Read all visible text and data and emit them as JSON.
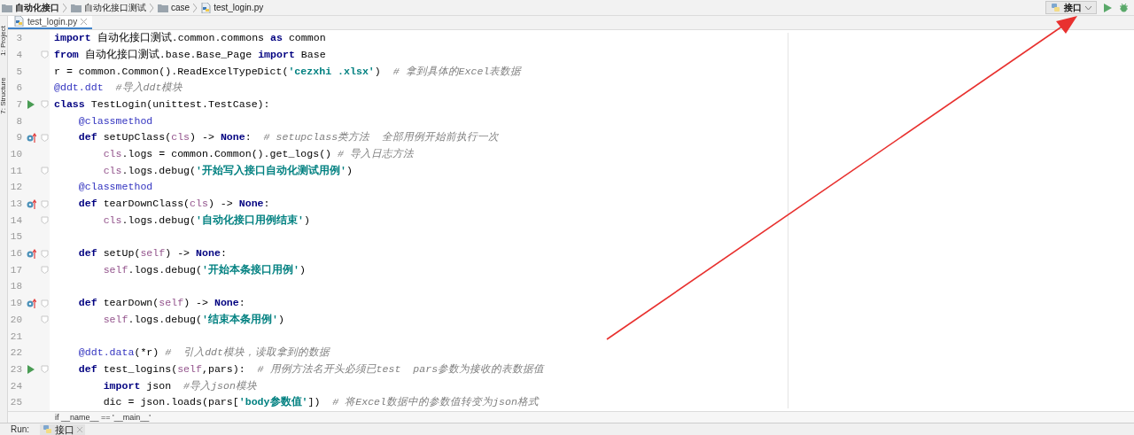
{
  "breadcrumbs": [
    {
      "label": "自动化接口",
      "bold": true
    },
    {
      "label": "自动化接口测试",
      "bold": false
    },
    {
      "label": "case",
      "bold": false
    },
    {
      "label": "test_login.py",
      "bold": false,
      "kind": "file"
    }
  ],
  "toolbar": {
    "run_config": "接口"
  },
  "tool_strip": [
    "1: Project",
    "7: Structure"
  ],
  "tabs": [
    {
      "label": "test_login.py",
      "selected": true
    }
  ],
  "code_lines": [
    {
      "number": "3",
      "fold": false,
      "tokens": [
        {
          "kind": "kw",
          "text": "import"
        },
        {
          "kind": "plain",
          "text": " 自动化接口测试.common.commons "
        },
        {
          "kind": "kw",
          "text": "as"
        },
        {
          "kind": "plain",
          "text": " common"
        }
      ]
    },
    {
      "number": "4",
      "fold": true,
      "tokens": [
        {
          "kind": "kw",
          "text": "from"
        },
        {
          "kind": "plain",
          "text": " 自动化接口测试.base.Base_Page "
        },
        {
          "kind": "kw",
          "text": "import"
        },
        {
          "kind": "plain",
          "text": " Base"
        }
      ]
    },
    {
      "number": "5",
      "fold": false,
      "tokens": [
        {
          "kind": "plain",
          "text": "r = common.Common().ReadExcelTypeDict("
        },
        {
          "kind": "str",
          "text": "'cezxhi .xlsx'"
        },
        {
          "kind": "plain",
          "text": ")"
        },
        {
          "kind": "cm",
          "text": "  # 拿到具体的Excel表数据"
        }
      ]
    },
    {
      "number": "6",
      "fold": false,
      "tokens": [
        {
          "kind": "deco",
          "text": "@ddt.ddt"
        },
        {
          "kind": "cm",
          "text": "  #导入ddt模块"
        }
      ]
    },
    {
      "number": "7",
      "gutter_icon": {
        "kind": "run"
      },
      "fold": true,
      "tokens": [
        {
          "kind": "kw",
          "text": "class"
        },
        {
          "kind": "plain",
          "text": " TestLogin(unittest.TestCase):"
        }
      ]
    },
    {
      "number": "8",
      "fold": false,
      "tokens": [
        {
          "kind": "deco",
          "text": "    @classmethod"
        }
      ]
    },
    {
      "number": "9",
      "gutter_icon": {
        "kind": "override"
      },
      "fold": true,
      "tokens": [
        {
          "kind": "kw",
          "text": "    def"
        },
        {
          "kind": "plain",
          "text": " setUpClass("
        },
        {
          "kind": "self",
          "text": "cls"
        },
        {
          "kind": "plain",
          "text": ") -> "
        },
        {
          "kind": "kw",
          "text": "None"
        },
        {
          "kind": "plain",
          "text": ":"
        },
        {
          "kind": "cm",
          "text": "  # setupclass类方法  全部用例开始前执行一次"
        }
      ]
    },
    {
      "number": "10",
      "fold": false,
      "tokens": [
        {
          "kind": "self",
          "text": "        cls"
        },
        {
          "kind": "plain",
          "text": ".logs = common.Common().get_logs()"
        },
        {
          "kind": "cm",
          "text": " # 导入日志方法"
        }
      ]
    },
    {
      "number": "11",
      "fold": true,
      "tokens": [
        {
          "kind": "self",
          "text": "        cls"
        },
        {
          "kind": "plain",
          "text": ".logs.debug("
        },
        {
          "kind": "str",
          "text": "'开始写入接口自动化测试用例'"
        },
        {
          "kind": "plain",
          "text": ")"
        }
      ]
    },
    {
      "number": "12",
      "fold": false,
      "tokens": [
        {
          "kind": "deco",
          "text": "    @classmethod"
        }
      ]
    },
    {
      "number": "13",
      "gutter_icon": {
        "kind": "override"
      },
      "fold": true,
      "tokens": [
        {
          "kind": "kw",
          "text": "    def"
        },
        {
          "kind": "plain",
          "text": " tearDownClass("
        },
        {
          "kind": "self",
          "text": "cls"
        },
        {
          "kind": "plain",
          "text": ") -> "
        },
        {
          "kind": "kw",
          "text": "None"
        },
        {
          "kind": "plain",
          "text": ":"
        }
      ]
    },
    {
      "number": "14",
      "fold": true,
      "tokens": [
        {
          "kind": "self",
          "text": "        cls"
        },
        {
          "kind": "plain",
          "text": ".logs.debug("
        },
        {
          "kind": "str",
          "text": "'自动化接口用例结束'"
        },
        {
          "kind": "plain",
          "text": ")"
        }
      ]
    },
    {
      "number": "15",
      "fold": false
    },
    {
      "number": "16",
      "gutter_icon": {
        "kind": "override"
      },
      "fold": true,
      "tokens": [
        {
          "kind": "kw",
          "text": "    def"
        },
        {
          "kind": "plain",
          "text": " setUp("
        },
        {
          "kind": "self",
          "text": "self"
        },
        {
          "kind": "plain",
          "text": ") -> "
        },
        {
          "kind": "kw",
          "text": "None"
        },
        {
          "kind": "plain",
          "text": ":"
        }
      ]
    },
    {
      "number": "17",
      "fold": true,
      "tokens": [
        {
          "kind": "self",
          "text": "        self"
        },
        {
          "kind": "plain",
          "text": ".logs.debug("
        },
        {
          "kind": "str",
          "text": "'开始本条接口用例'"
        },
        {
          "kind": "plain",
          "text": ")"
        }
      ]
    },
    {
      "number": "18",
      "fold": false
    },
    {
      "number": "19",
      "gutter_icon": {
        "kind": "override"
      },
      "fold": true,
      "tokens": [
        {
          "kind": "kw",
          "text": "    def"
        },
        {
          "kind": "plain",
          "text": " tearDown("
        },
        {
          "kind": "self",
          "text": "self"
        },
        {
          "kind": "plain",
          "text": ") -> "
        },
        {
          "kind": "kw",
          "text": "None"
        },
        {
          "kind": "plain",
          "text": ":"
        }
      ]
    },
    {
      "number": "20",
      "fold": true,
      "tokens": [
        {
          "kind": "self",
          "text": "        self"
        },
        {
          "kind": "plain",
          "text": ".logs.debug("
        },
        {
          "kind": "str",
          "text": "'结束本条用例'"
        },
        {
          "kind": "plain",
          "text": ")"
        }
      ]
    },
    {
      "number": "21",
      "fold": false
    },
    {
      "number": "22",
      "fold": false,
      "tokens": [
        {
          "kind": "deco",
          "text": "    @ddt.data"
        },
        {
          "kind": "plain",
          "text": "(*r)"
        },
        {
          "kind": "cm",
          "text": " #  引入ddt模块，读取拿到的数据"
        }
      ]
    },
    {
      "number": "23",
      "gutter_icon": {
        "kind": "run"
      },
      "fold": true,
      "tokens": [
        {
          "kind": "kw",
          "text": "    def"
        },
        {
          "kind": "plain",
          "text": " test_logins("
        },
        {
          "kind": "self",
          "text": "self"
        },
        {
          "kind": "plain",
          "text": ",pars):"
        },
        {
          "kind": "cm",
          "text": "  # 用例方法名开头必须已test  pars参数为接收的表数据值"
        }
      ]
    },
    {
      "number": "24",
      "fold": false,
      "tokens": [
        {
          "kind": "kw",
          "text": "        import"
        },
        {
          "kind": "plain",
          "text": " json"
        },
        {
          "kind": "cm",
          "text": "  #导入json模块"
        }
      ]
    },
    {
      "number": "25",
      "fold": false,
      "tokens": [
        {
          "kind": "plain",
          "text": "        dic = json.loads(pars["
        },
        {
          "kind": "str",
          "text": "'body参数值'"
        },
        {
          "kind": "plain",
          "text": "])"
        },
        {
          "kind": "cm",
          "text": "  # 将Excel数据中的参数值转变为json格式"
        }
      ]
    }
  ],
  "footer_breadcrumb": "if __name__ == '__main__'",
  "run_panel": {
    "label": "Run:",
    "tabs": [
      {
        "label": "接口",
        "selected": true
      }
    ]
  },
  "annotation": {
    "kind": "arrow"
  }
}
